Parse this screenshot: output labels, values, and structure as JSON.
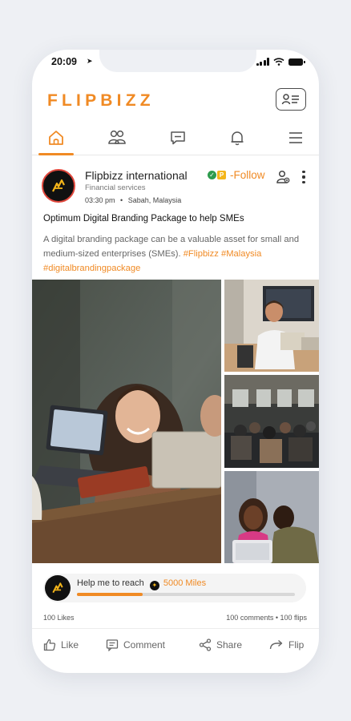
{
  "status_bar": {
    "time": "20:09"
  },
  "app": {
    "logo": "FLIPBIZZ",
    "brand_color": "#f08a24"
  },
  "nav": {
    "tabs": [
      {
        "icon": "home-icon",
        "active": true
      },
      {
        "icon": "users-icon",
        "active": false
      },
      {
        "icon": "chat-icon",
        "active": false
      },
      {
        "icon": "bell-icon",
        "active": false
      },
      {
        "icon": "menu-icon",
        "active": false
      }
    ]
  },
  "post": {
    "author": "Flipbizz international",
    "follow_label": "-Follow",
    "category": "Financial services",
    "time": "03:30 pm",
    "separator": "•",
    "location": "Sabah, Malaysia",
    "title": "Optimum Digital Branding Package to help SMEs",
    "body": "A digital branding package can be a valuable asset for small and medium-sized enterprises (SMEs).",
    "hashtags": [
      "#Flipbizz",
      "#Malaysia",
      "#digitalbrandingpackage"
    ]
  },
  "progress": {
    "label": "Help me to reach",
    "goal": "5000 Miles",
    "fraction": 0.3
  },
  "stats": {
    "likes": "100 Likes",
    "comments_flips": "100 comments • 100 flips"
  },
  "actions": {
    "like": "Like",
    "comment": "Comment",
    "share": "Share",
    "flip": "Flip"
  }
}
